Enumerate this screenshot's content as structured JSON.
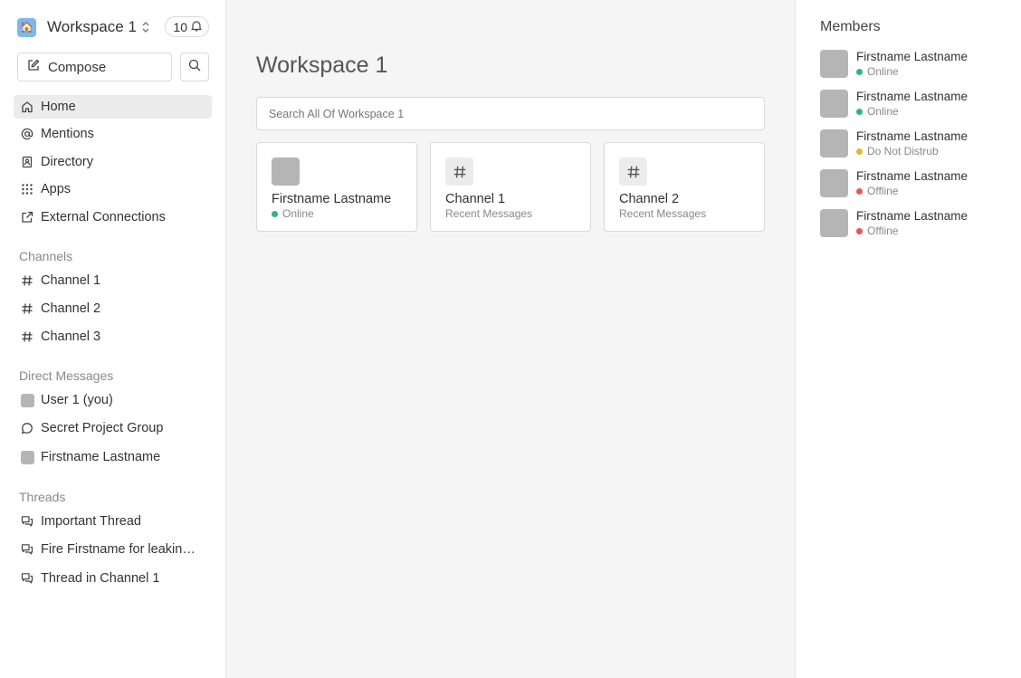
{
  "workspace": {
    "name": "Workspace 1",
    "logo_emoji": "🏠",
    "notification_count": "10"
  },
  "sidebar": {
    "compose_label": "Compose",
    "nav": [
      {
        "label": "Home",
        "icon": "home-icon"
      },
      {
        "label": "Mentions",
        "icon": "at-icon"
      },
      {
        "label": "Directory",
        "icon": "contacts-icon"
      },
      {
        "label": "Apps",
        "icon": "grid-icon"
      },
      {
        "label": "External Connections",
        "icon": "external-link-icon"
      }
    ],
    "channels_title": "Channels",
    "channels": [
      {
        "label": "Channel 1"
      },
      {
        "label": "Channel 2"
      },
      {
        "label": "Channel 3"
      }
    ],
    "dm_title": "Direct Messages",
    "dms": [
      {
        "label": "User 1 (you)",
        "icon": "avatar"
      },
      {
        "label": "Secret Project Group",
        "icon": "chat-bubble-icon"
      },
      {
        "label": "Firstname Lastname",
        "icon": "avatar"
      }
    ],
    "threads_title": "Threads",
    "threads": [
      {
        "label": "Important Thread"
      },
      {
        "label": "Fire Firstname for leaking i..."
      },
      {
        "label": "Thread in Channel 1"
      }
    ]
  },
  "main": {
    "title": "Workspace 1",
    "search_placeholder": "Search All Of Workspace 1",
    "cards": [
      {
        "title": "Firstname Lastname",
        "subtitle": "Online",
        "type": "user"
      },
      {
        "title": "Channel 1",
        "subtitle": "Recent Messages",
        "type": "channel"
      },
      {
        "title": "Channel 2",
        "subtitle": "Recent Messages",
        "type": "channel"
      }
    ]
  },
  "members": {
    "title": "Members",
    "list": [
      {
        "name": "Firstname Lastname",
        "status": "Online",
        "status_color": "#2fb57f"
      },
      {
        "name": "Firstname Lastname",
        "status": "Online",
        "status_color": "#2fb57f"
      },
      {
        "name": "Firstname Lastname",
        "status": "Do Not Distrub",
        "status_color": "#e0b82a"
      },
      {
        "name": "Firstname Lastname",
        "status": "Offline",
        "status_color": "#e85555"
      },
      {
        "name": "Firstname Lastname",
        "status": "Offline",
        "status_color": "#e85555"
      }
    ]
  },
  "colors": {
    "online": "#2fb57f",
    "dnd": "#e0b82a",
    "offline": "#e85555"
  }
}
